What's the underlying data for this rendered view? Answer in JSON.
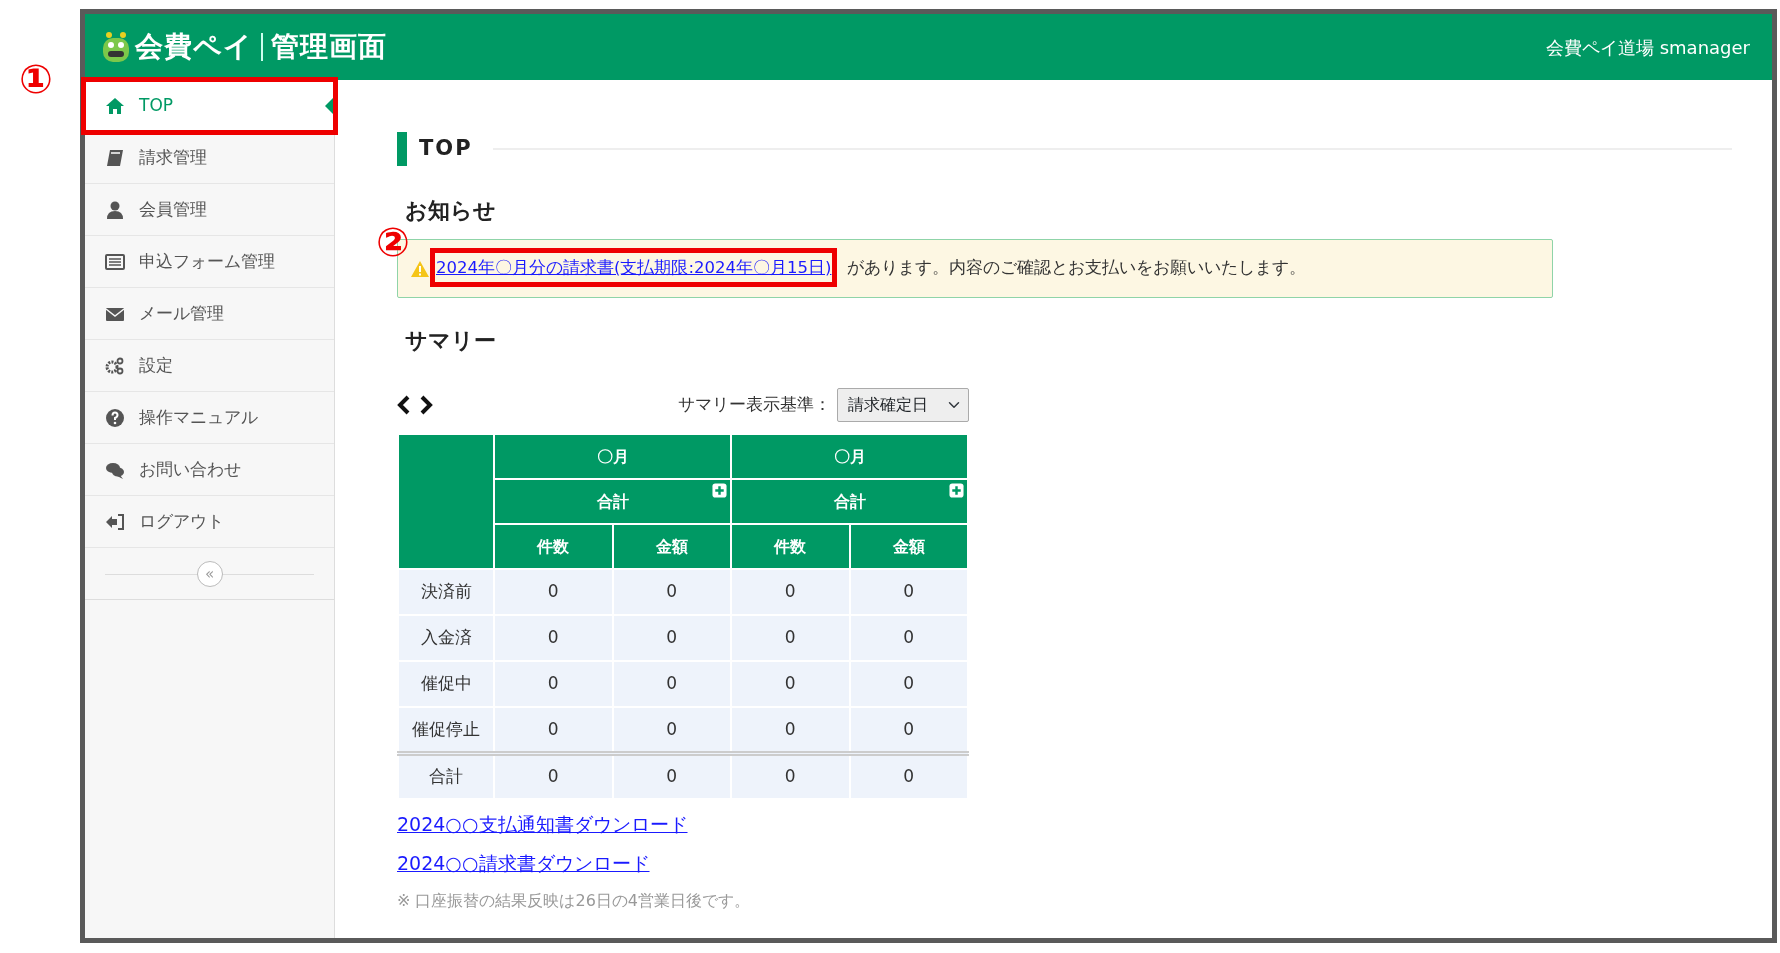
{
  "header": {
    "logo_text": "会費ペイ",
    "logo_sub": "管理画面",
    "account": "会費ペイ道場 smanager"
  },
  "sidebar": {
    "items": [
      {
        "label": "TOP",
        "selected": true
      },
      {
        "label": "請求管理",
        "selected": false
      },
      {
        "label": "会員管理",
        "selected": false
      },
      {
        "label": "申込フォーム管理",
        "selected": false
      },
      {
        "label": "メール管理",
        "selected": false
      },
      {
        "label": "設定",
        "selected": false
      },
      {
        "label": "操作マニュアル",
        "selected": false
      },
      {
        "label": "お問い合わせ",
        "selected": false
      },
      {
        "label": "ログアウト",
        "selected": false
      }
    ],
    "collapse": "«"
  },
  "page_title": "TOP",
  "notice": {
    "heading": "お知らせ",
    "link": "2024年〇月分の請求書(支払期限:2024年〇月15日)",
    "text": "があります。内容のご確認とお支払いをお願いいたします。"
  },
  "summary": {
    "heading": "サマリー",
    "basis_label": "サマリー表示基準：",
    "basis_value": "請求確定日",
    "months": [
      {
        "label": "〇月",
        "subtotal": "合計",
        "columns": [
          "件数",
          "金額"
        ]
      },
      {
        "label": "〇月",
        "subtotal": "合計",
        "columns": [
          "件数",
          "金額"
        ]
      }
    ],
    "rows": [
      {
        "label": "決済前",
        "values": [
          "0",
          "0",
          "0",
          "0"
        ]
      },
      {
        "label": "入金済",
        "values": [
          "0",
          "0",
          "0",
          "0"
        ]
      },
      {
        "label": "催促中",
        "values": [
          "0",
          "0",
          "0",
          "0"
        ]
      },
      {
        "label": "催促停止",
        "values": [
          "0",
          "0",
          "0",
          "0"
        ]
      }
    ],
    "total": {
      "label": "合計",
      "values": [
        "0",
        "0",
        "0",
        "0"
      ]
    }
  },
  "links": [
    "2024○○支払通知書ダウンロード",
    "2024○○請求書ダウンロード"
  ],
  "notes": [
    "※ 口座振替の結果反映は26日の4営業日後です。"
  ],
  "annotations": [
    "①",
    "②"
  ]
}
